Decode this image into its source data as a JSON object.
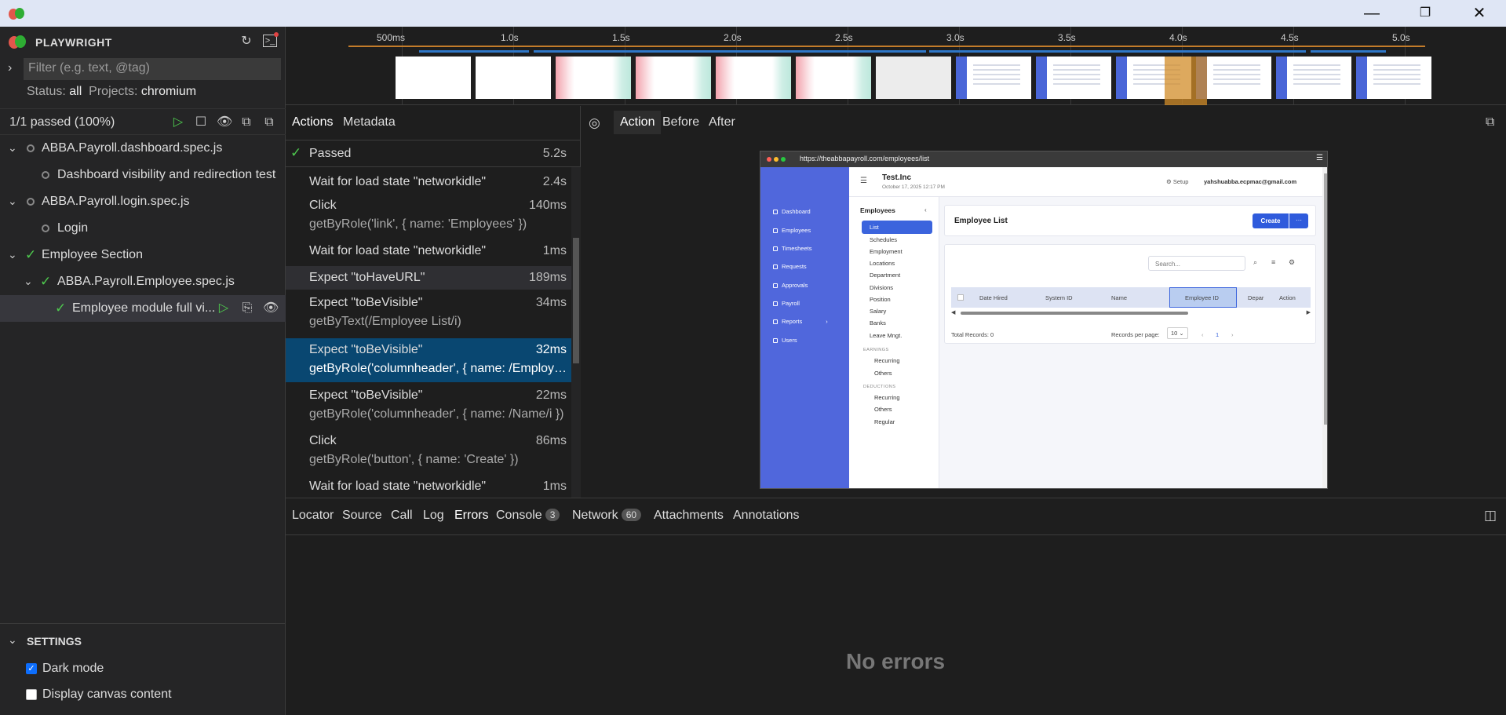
{
  "window": {
    "minimize": "—",
    "restore": "❐",
    "close": "✕"
  },
  "sidebar": {
    "app_title": "PLAYWRIGHT",
    "filter_placeholder": "Filter (e.g. text, @tag)",
    "status_label": "Status:",
    "status_value": "all",
    "projects_label": "Projects:",
    "projects_value": "chromium",
    "summary": "1/1 passed (100%)",
    "tree": [
      {
        "label": "ABBA.Payroll.dashboard.spec.js",
        "state": "skipped"
      },
      {
        "label": "Dashboard visibility and redirection test",
        "state": "skipped"
      },
      {
        "label": "ABBA.Payroll.login.spec.js",
        "state": "skipped"
      },
      {
        "label": "Login",
        "state": "skipped"
      },
      {
        "label": "Employee Section",
        "state": "passed"
      },
      {
        "label": "ABBA.Payroll.Employee.spec.js",
        "state": "passed"
      },
      {
        "label": "Employee module full vi...",
        "state": "passed"
      }
    ],
    "settings_title": "SETTINGS",
    "dark_mode_label": "Dark mode",
    "dark_mode_checked": true,
    "canvas_label": "Display canvas content",
    "canvas_checked": false
  },
  "timeline": {
    "ticks": [
      "500ms",
      "1.0s",
      "1.5s",
      "2.0s",
      "2.5s",
      "3.0s",
      "3.5s",
      "4.0s",
      "4.5s",
      "5.0s"
    ]
  },
  "actions_panel": {
    "tabs": [
      "Actions",
      "Metadata"
    ],
    "status": "Passed",
    "duration": "5.2s",
    "actions": [
      {
        "title": "Wait for load state \"networkidle\"",
        "duration": "2.4s",
        "sub": ""
      },
      {
        "title": "Click",
        "duration": "140ms",
        "sub": "getByRole('link', { name: 'Employees' })"
      },
      {
        "title": "Wait for load state \"networkidle\"",
        "duration": "1ms",
        "sub": ""
      },
      {
        "title": "Expect \"toHaveURL\"",
        "duration": "189ms",
        "sub": ""
      },
      {
        "title": "Expect \"toBeVisible\"",
        "duration": "34ms",
        "sub": "getByText(/Employee List/i)"
      },
      {
        "title": "Expect \"toBeVisible\"",
        "duration": "32ms",
        "sub": "getByRole('columnheader', { name: /Employee ..."
      },
      {
        "title": "Expect \"toBeVisible\"",
        "duration": "22ms",
        "sub": "getByRole('columnheader', { name: /Name/i })"
      },
      {
        "title": "Click",
        "duration": "86ms",
        "sub": "getByRole('button', { name: 'Create' })"
      },
      {
        "title": "Wait for load state \"networkidle\"",
        "duration": "1ms",
        "sub": ""
      }
    ]
  },
  "snapshot": {
    "tabs": [
      "Action",
      "Before",
      "After"
    ],
    "url": "https://theabbapayroll.com/employees/list",
    "company": "Test.Inc",
    "datetime": "October 17, 2025 12:17 PM",
    "setup": "Setup",
    "user_email": "yahshuabba.ecpmac@gmail.com",
    "nav": [
      "Dashboard",
      "Employees",
      "Timesheets",
      "Requests",
      "Approvals",
      "Payroll",
      "Reports",
      "Users"
    ],
    "employees_title": "Employees",
    "employee_menu": [
      "List",
      "Schedules",
      "Employment",
      "Locations",
      "Department",
      "Divisions",
      "Position",
      "Salary",
      "Banks",
      "Leave Mngt."
    ],
    "earnings_label": "EARNINGS",
    "earnings": [
      "Recurring",
      "Others"
    ],
    "deductions_label": "DEDUCTIONS",
    "deductions": [
      "Recurring",
      "Others",
      "Regular"
    ],
    "page_title": "Employee List",
    "create_label": "Create",
    "more_label": "···",
    "search_placeholder": "Search...",
    "columns": [
      "Date Hired",
      "System ID",
      "Name",
      "Employee ID",
      "Depar",
      "Action"
    ],
    "total_records": "Total Records: 0",
    "per_page_label": "Records per page:",
    "per_page_value": "10",
    "page_number": "1"
  },
  "bottom_tabs": {
    "tabs": [
      "Locator",
      "Source",
      "Call",
      "Log",
      "Errors",
      "Console",
      "Network",
      "Attachments",
      "Annotations"
    ],
    "console_count": "3",
    "network_count": "60",
    "empty_message": "No errors"
  }
}
